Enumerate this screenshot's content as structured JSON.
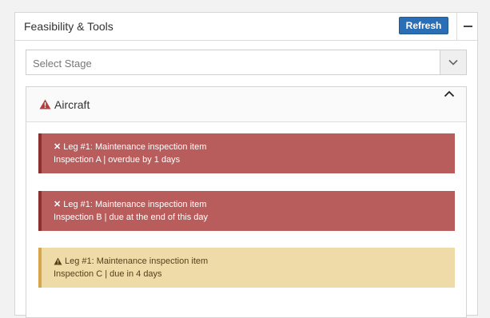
{
  "panel": {
    "title": "Feasibility & Tools",
    "refresh_label": "Refresh"
  },
  "stage_select": {
    "placeholder": "Select Stage"
  },
  "aircraft": {
    "title": "Aircraft",
    "alerts": [
      {
        "severity": "danger",
        "icon": "x-icon",
        "title": "Leg #1: Maintenance inspection item",
        "detail": "Inspection A | overdue by 1 days"
      },
      {
        "severity": "danger",
        "icon": "x-icon",
        "title": "Leg #1: Maintenance inspection item",
        "detail": "Inspection B | due at the end of this day"
      },
      {
        "severity": "warning",
        "icon": "warning-triangle-icon",
        "title": "Leg #1: Maintenance inspection item",
        "detail": "Inspection C | due in 4 days"
      }
    ]
  },
  "colors": {
    "primary_button": "#2a6fb5",
    "danger_bg": "#b85c5c",
    "warning_bg": "#eedba8",
    "danger_icon": "#b83b3b"
  }
}
